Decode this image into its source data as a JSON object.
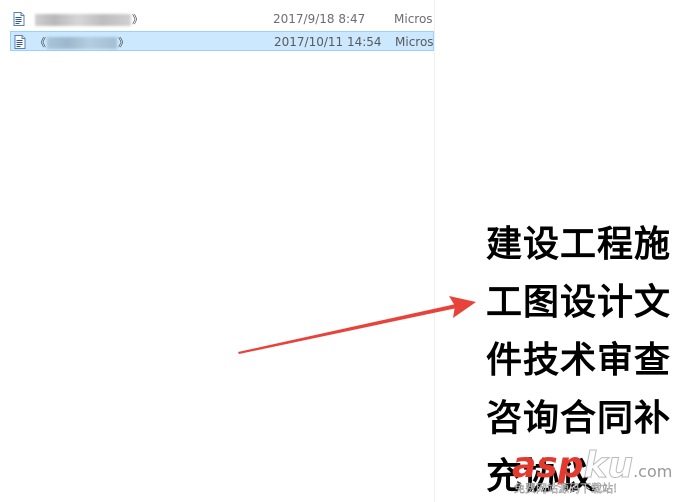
{
  "files": [
    {
      "name_open": "",
      "name_close": "》",
      "date": "2017/9/18 8:47",
      "type": "Micros",
      "selected": false,
      "icon": "word-document-icon"
    },
    {
      "name_open": "《",
      "name_close": "》",
      "date": "2017/10/11 14:54",
      "type": "Micros",
      "selected": true,
      "icon": "word-document-icon"
    }
  ],
  "document": {
    "lines": [
      "建设工程施",
      "工图设计文",
      "件技术审查",
      "咨询合同补",
      "充协议"
    ]
  },
  "annotation": {
    "arrow_color": "#e8433a"
  },
  "watermark": {
    "logo_asp": "asp",
    "logo_ku": "ku",
    "logo_com": ".com",
    "slogan": "免费网站源码下载站!"
  },
  "colors": {
    "selection_bg": "#cce8ff",
    "selection_border": "#99d1ff",
    "brand_red": "#e23a2e"
  }
}
